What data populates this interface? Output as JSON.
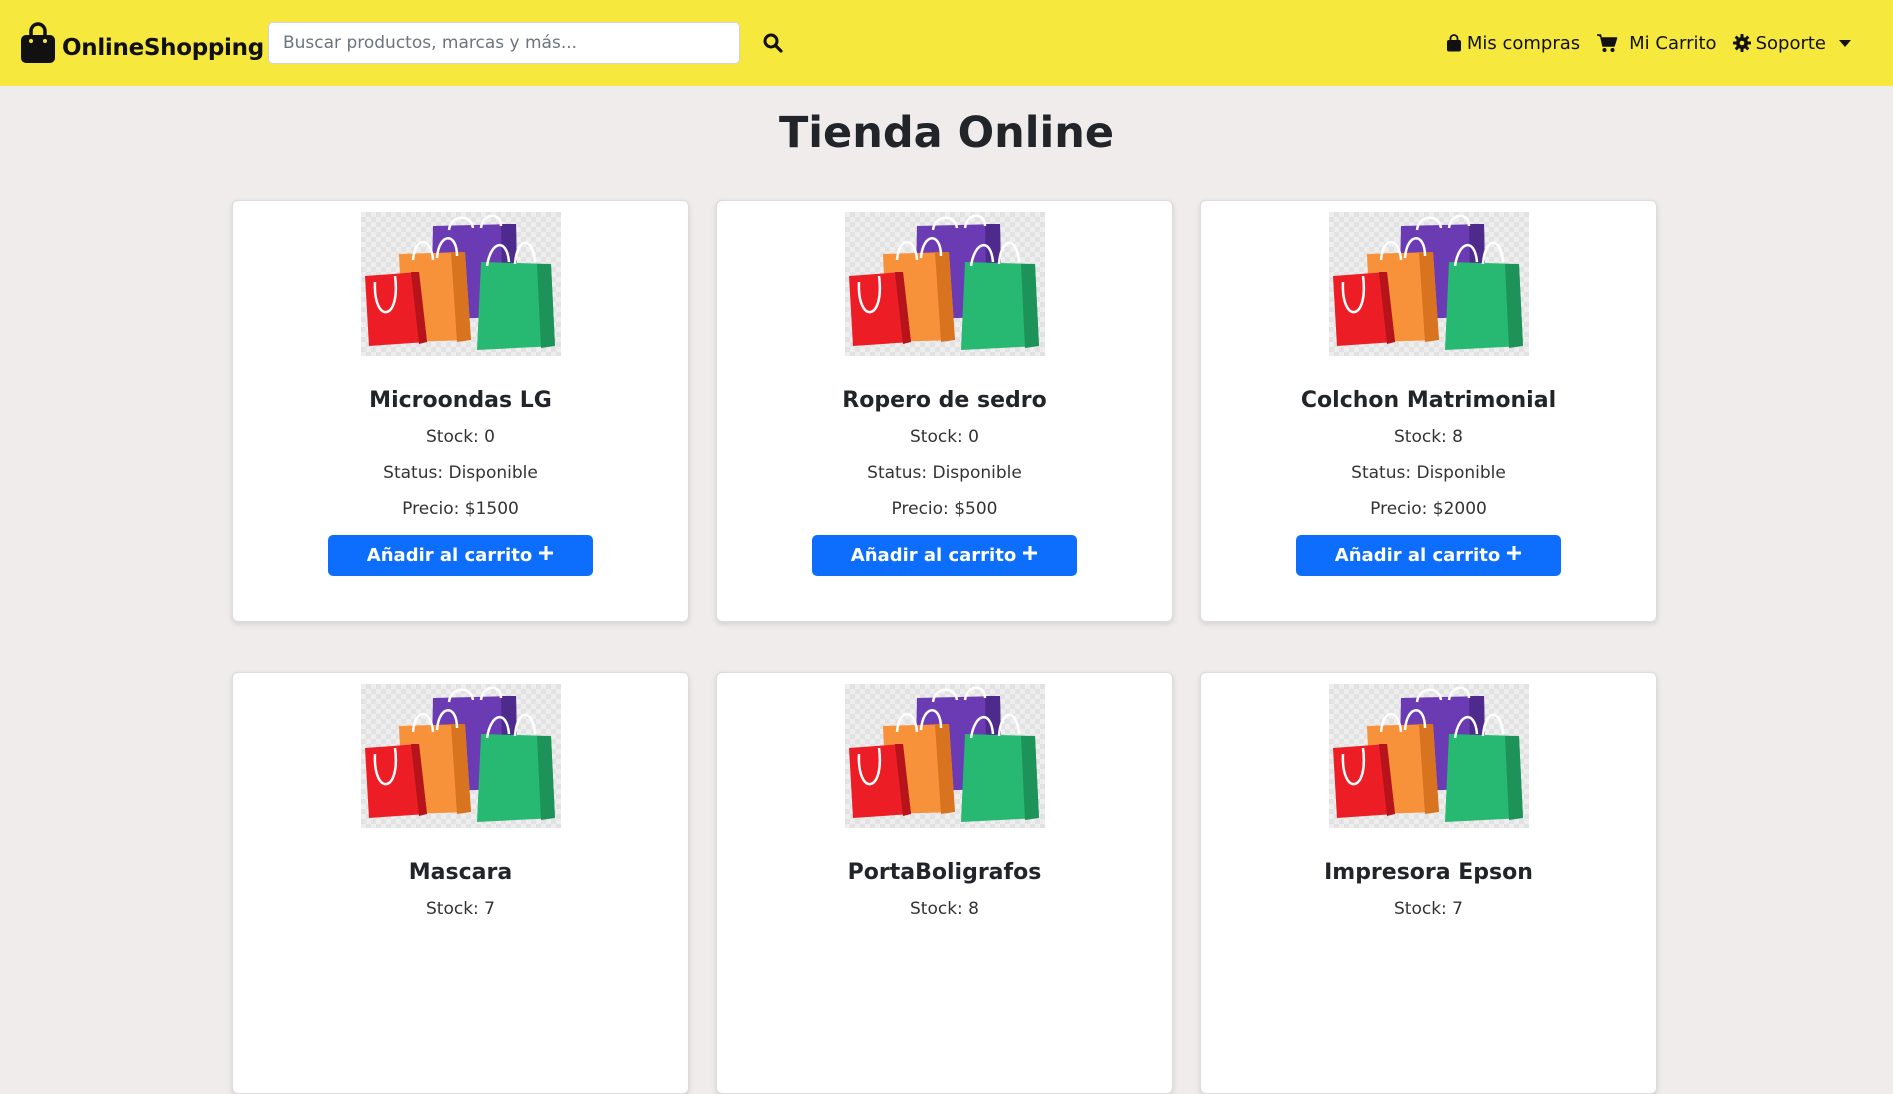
{
  "navbar": {
    "brand": "OnlineShopping",
    "search_placeholder": "Buscar productos, marcas y más...",
    "links": {
      "purchases": "Mis compras",
      "cart": "Mi Carrito",
      "support": "Soporte"
    },
    "bg_color": "#f7e83d"
  },
  "page": {
    "title": "Tienda Online"
  },
  "labels": {
    "stock": "Stock: ",
    "status": "Status: ",
    "price": "Precio: ",
    "add_to_cart": "Añadir al carrito"
  },
  "products": [
    {
      "name": "Microondas LG",
      "stock": "0",
      "status": "Disponible",
      "price": "$1500"
    },
    {
      "name": "Ropero de sedro",
      "stock": "0",
      "status": "Disponible",
      "price": "$500"
    },
    {
      "name": "Colchon Matrimonial",
      "stock": "8",
      "status": "Disponible",
      "price": "$2000"
    },
    {
      "name": "Mascara",
      "stock": "7"
    },
    {
      "name": "PortaBoligrafos",
      "stock": "8"
    },
    {
      "name": "Impresora Epson",
      "stock": "7"
    }
  ],
  "icons": {
    "brand": "shopping-bag-icon",
    "search": "search-icon",
    "purchases": "bag-icon",
    "cart": "cart-icon",
    "support": "gear-icon",
    "add": "plus-icon",
    "product_image": "shopping-bags-image"
  },
  "colors": {
    "primary_button": "#0d6efd",
    "page_bg": "#f0ecec"
  }
}
